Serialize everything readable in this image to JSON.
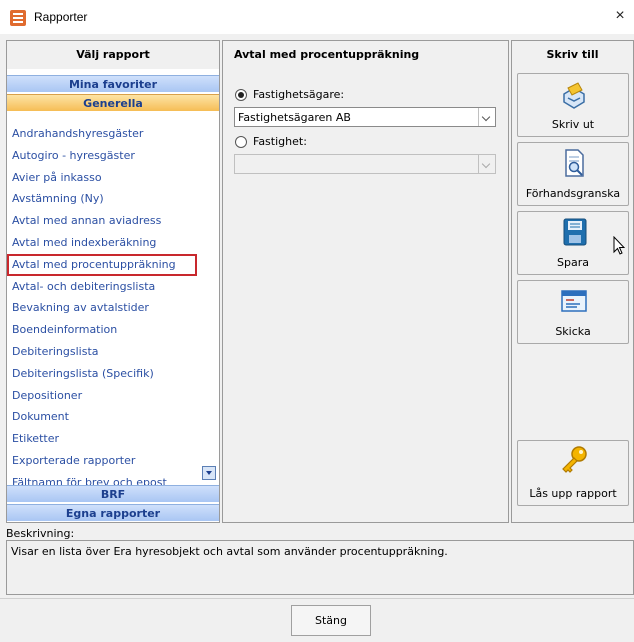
{
  "window": {
    "title": "Rapporter",
    "close_glyph": "×"
  },
  "left_panel": {
    "header": "Välj rapport",
    "groups": [
      "Mina favoriter",
      "Generella",
      "BRF",
      "Egna rapporter"
    ],
    "reports": [
      "Andrahandshyresgäster",
      "Autogiro - hyresgäster",
      "Avier på inkasso",
      "Avstämning (Ny)",
      "Avtal med annan aviadress",
      "Avtal med indexberäkning",
      "Avtal med procentuppräkning",
      "Avtal- och debiteringslista",
      "Bevakning av avtalstider",
      "Boendeinformation",
      "Debiteringslista",
      "Debiteringslista (Specifik)",
      "Depositioner",
      "Dokument",
      "Etiketter",
      "Exporterade rapporter",
      "Fältnamn för brev och epost"
    ],
    "selected_report": "Avtal med procentuppräkning"
  },
  "middle_panel": {
    "header": "Avtal med procentuppräkning",
    "option_owner_label": "Fastighetsägare:",
    "option_owner_value": "Fastighetsägaren AB",
    "option_property_label": "Fastighet:",
    "option_property_value": ""
  },
  "right_panel": {
    "header": "Skriv till",
    "buttons": [
      "Skriv ut",
      "Förhandsgranska",
      "Spara",
      "Skicka",
      "Lås upp rapport"
    ]
  },
  "description": {
    "label": "Beskrivning:",
    "text": "Visar en lista över Era hyresobjekt och avtal som använder procentuppräkning."
  },
  "footer": {
    "close_label": "Stäng"
  },
  "colors": {
    "accent_link": "#2b4fa3",
    "group_header": "#a9c6f3",
    "active_group": "#f6bd55",
    "selection_outline": "#c8282d"
  }
}
